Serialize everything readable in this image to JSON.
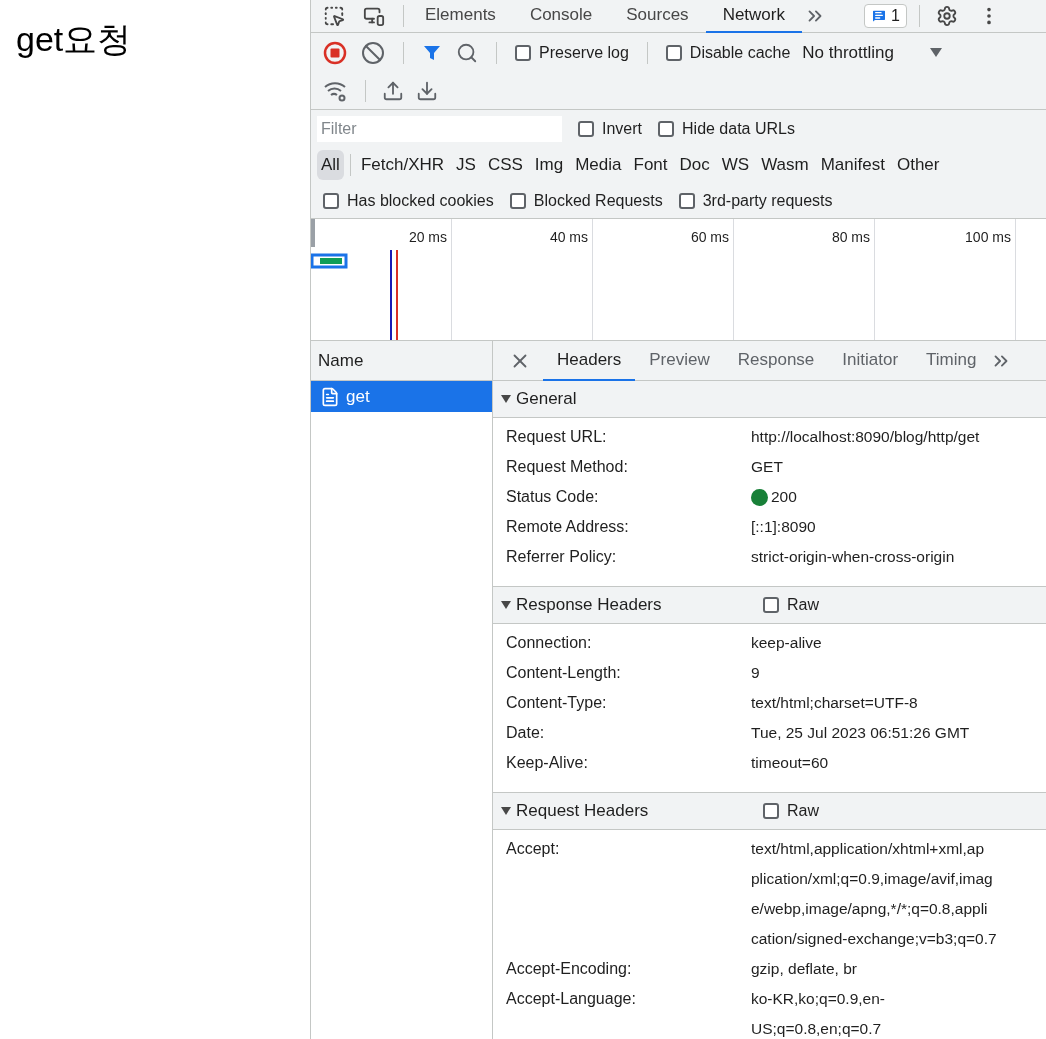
{
  "page": {
    "heading": "get요청"
  },
  "devtools": {
    "panel_tabs": [
      {
        "label": "Elements",
        "selected": false
      },
      {
        "label": "Console",
        "selected": false
      },
      {
        "label": "Sources",
        "selected": false
      },
      {
        "label": "Network",
        "selected": true
      }
    ],
    "issues_badge": "1",
    "toolbar": {
      "recording": true,
      "preserve_log": {
        "label": "Preserve log",
        "checked": false
      },
      "disable_cache": {
        "label": "Disable cache",
        "checked": false
      },
      "throttling": "No throttling"
    },
    "filter": {
      "placeholder": "Filter",
      "invert": {
        "label": "Invert",
        "checked": false
      },
      "hide_data_urls": {
        "label": "Hide data URLs",
        "checked": false
      }
    },
    "type_filters": [
      {
        "label": "All",
        "selected": true
      },
      {
        "label": "Fetch/XHR",
        "selected": false
      },
      {
        "label": "JS",
        "selected": false
      },
      {
        "label": "CSS",
        "selected": false
      },
      {
        "label": "Img",
        "selected": false
      },
      {
        "label": "Media",
        "selected": false
      },
      {
        "label": "Font",
        "selected": false
      },
      {
        "label": "Doc",
        "selected": false
      },
      {
        "label": "WS",
        "selected": false
      },
      {
        "label": "Wasm",
        "selected": false
      },
      {
        "label": "Manifest",
        "selected": false
      },
      {
        "label": "Other",
        "selected": false
      }
    ],
    "checkbox_filters": [
      {
        "label": "Has blocked cookies",
        "checked": false
      },
      {
        "label": "Blocked Requests",
        "checked": false
      },
      {
        "label": "3rd-party requests",
        "checked": false
      }
    ],
    "timeline": {
      "ticks": [
        "20 ms",
        "40 ms",
        "60 ms",
        "80 ms",
        "100 ms"
      ]
    },
    "requests": {
      "column": "Name",
      "rows": [
        {
          "name": "get",
          "selected": true
        }
      ]
    },
    "detail_tabs": [
      {
        "label": "Headers",
        "selected": true
      },
      {
        "label": "Preview",
        "selected": false
      },
      {
        "label": "Response",
        "selected": false
      },
      {
        "label": "Initiator",
        "selected": false
      },
      {
        "label": "Timing",
        "selected": false
      }
    ],
    "sections": [
      {
        "title": "General",
        "expanded": true,
        "rows": [
          {
            "kind": "text",
            "name": "Request URL:",
            "value": [
              "http://localhost:8090/blog/http/get"
            ]
          },
          {
            "kind": "text",
            "name": "Request Method:",
            "value": [
              "GET"
            ]
          },
          {
            "kind": "status",
            "name": "Status Code:",
            "value": [
              "200"
            ],
            "color": "#188038"
          },
          {
            "kind": "text",
            "name": "Remote Address:",
            "value": [
              "[::1]:8090"
            ]
          },
          {
            "kind": "text",
            "name": "Referrer Policy:",
            "value": [
              "strict-origin-when-cross-origin"
            ]
          }
        ]
      },
      {
        "title": "Response Headers",
        "expanded": true,
        "raw": {
          "label": "Raw",
          "checked": false
        },
        "rows": [
          {
            "kind": "text",
            "name": "Connection:",
            "value": [
              "keep-alive"
            ]
          },
          {
            "kind": "text",
            "name": "Content-Length:",
            "value": [
              "9"
            ]
          },
          {
            "kind": "text",
            "name": "Content-Type:",
            "value": [
              "text/html;charset=UTF-8"
            ]
          },
          {
            "kind": "text",
            "name": "Date:",
            "value": [
              "Tue, 25 Jul 2023 06:51:26 GMT"
            ]
          },
          {
            "kind": "text",
            "name": "Keep-Alive:",
            "value": [
              "timeout=60"
            ]
          }
        ]
      },
      {
        "title": "Request Headers",
        "expanded": true,
        "raw": {
          "label": "Raw",
          "checked": false
        },
        "rows": [
          {
            "kind": "text",
            "name": "Accept:",
            "value": [
              "text/html,application/xhtml+xml,ap",
              "plication/xml;q=0.9,image/avif,imag",
              "e/webp,image/apng,*/*;q=0.8,appli",
              "cation/signed-exchange;v=b3;q=0.7"
            ]
          },
          {
            "kind": "text",
            "name": "Accept-Encoding:",
            "value": [
              "gzip, deflate, br"
            ]
          },
          {
            "kind": "text",
            "name": "Accept-Language:",
            "value": [
              "ko-KR,ko;q=0.9,en-",
              "US;q=0.8,en;q=0.7"
            ]
          }
        ]
      }
    ]
  }
}
